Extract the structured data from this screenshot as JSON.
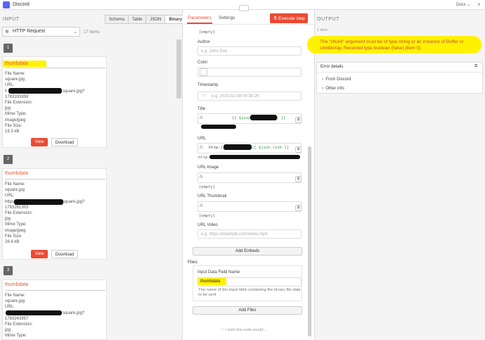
{
  "window": {
    "title": "Discord",
    "docs_label": "Docs",
    "docs_caret": "⌄",
    "close": "×"
  },
  "input": {
    "label": "INPUT",
    "source": "HTTP Request",
    "item_count": "17 items",
    "view_tabs": [
      "Schema",
      "Table",
      "JSON",
      "Binary"
    ],
    "active_tab": "Binary",
    "items": [
      {
        "index": "1",
        "title": "thumbdata",
        "lines": [
          "File Name:",
          "square.jpg",
          "URL:",
          "h",
          "square.jpg?",
          "1783193359",
          "File Extension:",
          "jpg",
          "Mime Type:",
          "image/jpeg",
          "File Size:",
          "18.3 kB"
        ],
        "view": "View",
        "download": "Download"
      },
      {
        "index": "2",
        "title": "thumbdata",
        "lines": [
          "File Name:",
          "square.jpg",
          "URL:",
          "https",
          "square.jpg?",
          "1783261303",
          "File Extension:",
          "jpg",
          "Mime Type:",
          "image/jpeg",
          "File Size:",
          "26.6 kB"
        ],
        "view": "View",
        "download": "Download"
      },
      {
        "index": "3",
        "title": "thumbdata",
        "lines": [
          "File Name:",
          "square.jpg",
          "URL:",
          "",
          "square.jpg?",
          "1783243957",
          "File Extension:",
          "jpg",
          "Mime Type:"
        ]
      }
    ]
  },
  "parameters": {
    "tabs": [
      "Parameters",
      "Settings"
    ],
    "execute": "Execute step",
    "top_value": "[empty]",
    "author_label": "Author",
    "author_placeholder": "e.g. John Doe",
    "color_label": "Color",
    "timestamp_label": "Timestamp",
    "timestamp_placeholder": "e.g. 2023-02-08 09:30:26",
    "title_label": "Title",
    "title_expr": "{{ $json[",
    "title_expr_end": "] }}",
    "url_label": "URL",
    "url_expr_start": "http://",
    "url_expr": "{{ $json.link }}",
    "url_resolved": "http:",
    "url_image_label": "URL Image",
    "url_image_value": "[empty]",
    "url_thumbnail_label": "URL Thumbnail",
    "url_thumbnail_value": "[empty]",
    "url_video_label": "URL Video",
    "url_video_placeholder": "e.g. https://example.com/video.mp4",
    "add_embeds": "Add Embeds",
    "files_label": "Files",
    "input_data_field_label": "Input Data Field Name",
    "input_data_field_value": "thumbdata",
    "input_data_field_hint": "The name of the input field containing the binary file data to be sent",
    "add_files": "Add Files",
    "feedback": "I wish this node would..."
  },
  "output": {
    "label": "OUTPUT",
    "item_count": "1 item",
    "error_message": "The \"chunk\" argument must be of type string or an instance of Buffer or Uint8Array. Received type boolean (false) [item 0]",
    "error_details_label": "Error details",
    "detail_items": [
      "From Discord",
      "Other info"
    ]
  },
  "colors": {
    "accent": "#ea4b33",
    "highlight": "#fff200",
    "title_red": "#e25c3c"
  }
}
